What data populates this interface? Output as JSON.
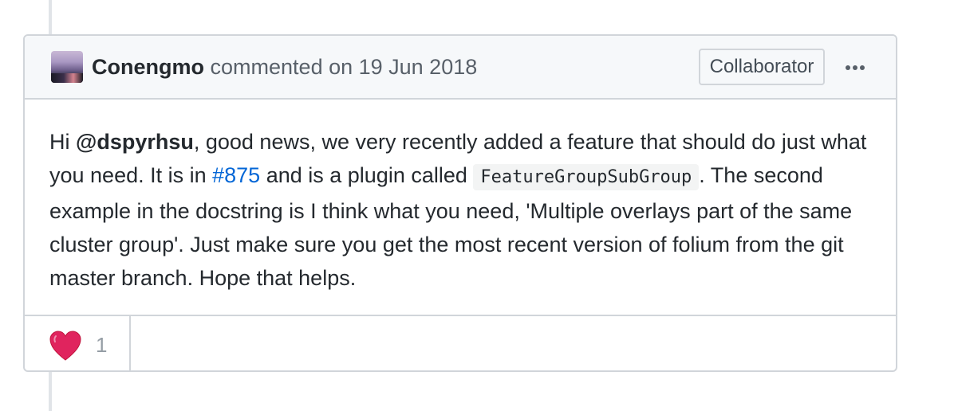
{
  "comment": {
    "author": "Conengmo",
    "meta": "commented on 19 Jun 2018",
    "badge": "Collaborator",
    "more_icon": "kebab-horizontal-icon",
    "body": {
      "p1": "Hi ",
      "mention": "@dspyrhsu",
      "p2": ", good news, we very recently added a feature that should do just what you need. It is in ",
      "issue_link": "#875",
      "p3": " and is a plugin called ",
      "code": "FeatureGroupSubGroup",
      "p4": ". The second example in the docstring is I think what you need, 'Multiple overlays part of the same cluster group'. Just make sure you get the most recent version of folium from the git master branch. Hope that helps."
    },
    "reactions": [
      {
        "icon": "heart-icon",
        "count": "1"
      }
    ]
  },
  "colors": {
    "link": "#0366d6",
    "border": "#d1d5da",
    "header_bg": "#f6f8fa",
    "heart": "#e0245e"
  }
}
